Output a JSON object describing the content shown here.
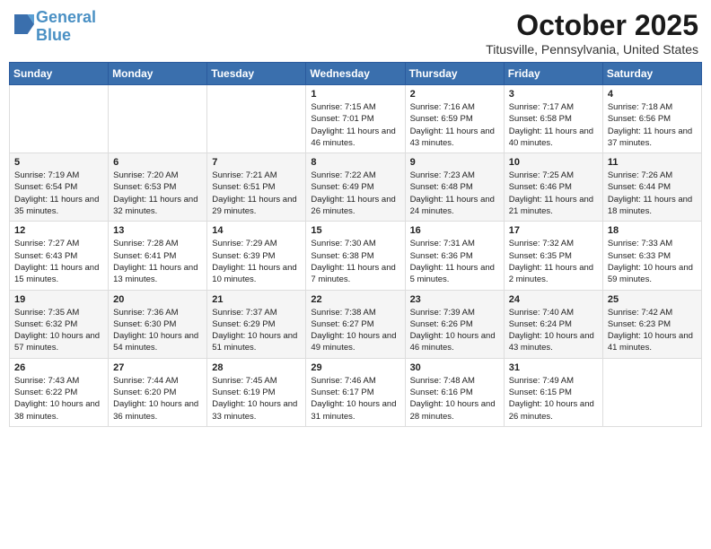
{
  "header": {
    "logo_line1": "General",
    "logo_line2": "Blue",
    "month": "October 2025",
    "location": "Titusville, Pennsylvania, United States"
  },
  "days_of_week": [
    "Sunday",
    "Monday",
    "Tuesday",
    "Wednesday",
    "Thursday",
    "Friday",
    "Saturday"
  ],
  "weeks": [
    [
      {
        "day": "",
        "info": ""
      },
      {
        "day": "",
        "info": ""
      },
      {
        "day": "",
        "info": ""
      },
      {
        "day": "1",
        "info": "Sunrise: 7:15 AM\nSunset: 7:01 PM\nDaylight: 11 hours and 46 minutes."
      },
      {
        "day": "2",
        "info": "Sunrise: 7:16 AM\nSunset: 6:59 PM\nDaylight: 11 hours and 43 minutes."
      },
      {
        "day": "3",
        "info": "Sunrise: 7:17 AM\nSunset: 6:58 PM\nDaylight: 11 hours and 40 minutes."
      },
      {
        "day": "4",
        "info": "Sunrise: 7:18 AM\nSunset: 6:56 PM\nDaylight: 11 hours and 37 minutes."
      }
    ],
    [
      {
        "day": "5",
        "info": "Sunrise: 7:19 AM\nSunset: 6:54 PM\nDaylight: 11 hours and 35 minutes."
      },
      {
        "day": "6",
        "info": "Sunrise: 7:20 AM\nSunset: 6:53 PM\nDaylight: 11 hours and 32 minutes."
      },
      {
        "day": "7",
        "info": "Sunrise: 7:21 AM\nSunset: 6:51 PM\nDaylight: 11 hours and 29 minutes."
      },
      {
        "day": "8",
        "info": "Sunrise: 7:22 AM\nSunset: 6:49 PM\nDaylight: 11 hours and 26 minutes."
      },
      {
        "day": "9",
        "info": "Sunrise: 7:23 AM\nSunset: 6:48 PM\nDaylight: 11 hours and 24 minutes."
      },
      {
        "day": "10",
        "info": "Sunrise: 7:25 AM\nSunset: 6:46 PM\nDaylight: 11 hours and 21 minutes."
      },
      {
        "day": "11",
        "info": "Sunrise: 7:26 AM\nSunset: 6:44 PM\nDaylight: 11 hours and 18 minutes."
      }
    ],
    [
      {
        "day": "12",
        "info": "Sunrise: 7:27 AM\nSunset: 6:43 PM\nDaylight: 11 hours and 15 minutes."
      },
      {
        "day": "13",
        "info": "Sunrise: 7:28 AM\nSunset: 6:41 PM\nDaylight: 11 hours and 13 minutes."
      },
      {
        "day": "14",
        "info": "Sunrise: 7:29 AM\nSunset: 6:39 PM\nDaylight: 11 hours and 10 minutes."
      },
      {
        "day": "15",
        "info": "Sunrise: 7:30 AM\nSunset: 6:38 PM\nDaylight: 11 hours and 7 minutes."
      },
      {
        "day": "16",
        "info": "Sunrise: 7:31 AM\nSunset: 6:36 PM\nDaylight: 11 hours and 5 minutes."
      },
      {
        "day": "17",
        "info": "Sunrise: 7:32 AM\nSunset: 6:35 PM\nDaylight: 11 hours and 2 minutes."
      },
      {
        "day": "18",
        "info": "Sunrise: 7:33 AM\nSunset: 6:33 PM\nDaylight: 10 hours and 59 minutes."
      }
    ],
    [
      {
        "day": "19",
        "info": "Sunrise: 7:35 AM\nSunset: 6:32 PM\nDaylight: 10 hours and 57 minutes."
      },
      {
        "day": "20",
        "info": "Sunrise: 7:36 AM\nSunset: 6:30 PM\nDaylight: 10 hours and 54 minutes."
      },
      {
        "day": "21",
        "info": "Sunrise: 7:37 AM\nSunset: 6:29 PM\nDaylight: 10 hours and 51 minutes."
      },
      {
        "day": "22",
        "info": "Sunrise: 7:38 AM\nSunset: 6:27 PM\nDaylight: 10 hours and 49 minutes."
      },
      {
        "day": "23",
        "info": "Sunrise: 7:39 AM\nSunset: 6:26 PM\nDaylight: 10 hours and 46 minutes."
      },
      {
        "day": "24",
        "info": "Sunrise: 7:40 AM\nSunset: 6:24 PM\nDaylight: 10 hours and 43 minutes."
      },
      {
        "day": "25",
        "info": "Sunrise: 7:42 AM\nSunset: 6:23 PM\nDaylight: 10 hours and 41 minutes."
      }
    ],
    [
      {
        "day": "26",
        "info": "Sunrise: 7:43 AM\nSunset: 6:22 PM\nDaylight: 10 hours and 38 minutes."
      },
      {
        "day": "27",
        "info": "Sunrise: 7:44 AM\nSunset: 6:20 PM\nDaylight: 10 hours and 36 minutes."
      },
      {
        "day": "28",
        "info": "Sunrise: 7:45 AM\nSunset: 6:19 PM\nDaylight: 10 hours and 33 minutes."
      },
      {
        "day": "29",
        "info": "Sunrise: 7:46 AM\nSunset: 6:17 PM\nDaylight: 10 hours and 31 minutes."
      },
      {
        "day": "30",
        "info": "Sunrise: 7:48 AM\nSunset: 6:16 PM\nDaylight: 10 hours and 28 minutes."
      },
      {
        "day": "31",
        "info": "Sunrise: 7:49 AM\nSunset: 6:15 PM\nDaylight: 10 hours and 26 minutes."
      },
      {
        "day": "",
        "info": ""
      }
    ]
  ]
}
